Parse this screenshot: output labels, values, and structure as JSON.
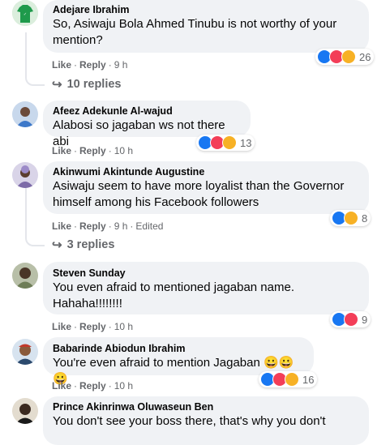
{
  "comments": [
    {
      "author": "Adejare Ibrahim",
      "text": "So, Asiwaju Bola Ahmed Tinubu is not worthy of your mention?",
      "like": "Like",
      "reply": "Reply",
      "time": "9 h",
      "edited": "",
      "reactions": [
        "like",
        "love",
        "haha"
      ],
      "count": "26",
      "replies": "10 replies"
    },
    {
      "author": "Afeez Adekunle Al-wajud",
      "text": "Alabosi so jagaban ws not there abi",
      "like": "Like",
      "reply": "Reply",
      "time": "10 h",
      "edited": "",
      "reactions": [
        "like",
        "love",
        "haha"
      ],
      "count": "13",
      "replies": ""
    },
    {
      "author": "Akinwumi Akintunde Augustine",
      "text": "Asiwaju seem to have more loyalist than the Governor himself among his Facebook followers",
      "like": "Like",
      "reply": "Reply",
      "time": "9 h",
      "edited": "Edited",
      "reactions": [
        "like",
        "haha"
      ],
      "count": "8",
      "replies": "3 replies"
    },
    {
      "author": "Steven Sunday",
      "text": "You even afraid to mentioned jagaban name. Hahaha!!!!!!!!",
      "like": "Like",
      "reply": "Reply",
      "time": "10 h",
      "edited": "",
      "reactions": [
        "like",
        "love"
      ],
      "count": "9",
      "replies": ""
    },
    {
      "author": "Babarinde Abiodun Ibrahim",
      "text": "You're even afraid to mention Jagaban 😀😀😀",
      "like": "Like",
      "reply": "Reply",
      "time": "10 h",
      "edited": "",
      "reactions": [
        "like",
        "love",
        "haha"
      ],
      "count": "16",
      "replies": ""
    },
    {
      "author": "Prince Akinrinwa Oluwaseun Ben",
      "text": "You don't see your boss there, that's why you don't",
      "like": "",
      "reply": "",
      "time": "",
      "edited": "",
      "reactions": [],
      "count": "",
      "replies": ""
    }
  ],
  "colors": {
    "like": "#1877f2",
    "love": "#f33e58",
    "haha": "#f7b125",
    "meta": "#65676b",
    "bubble": "#f0f2f5"
  }
}
